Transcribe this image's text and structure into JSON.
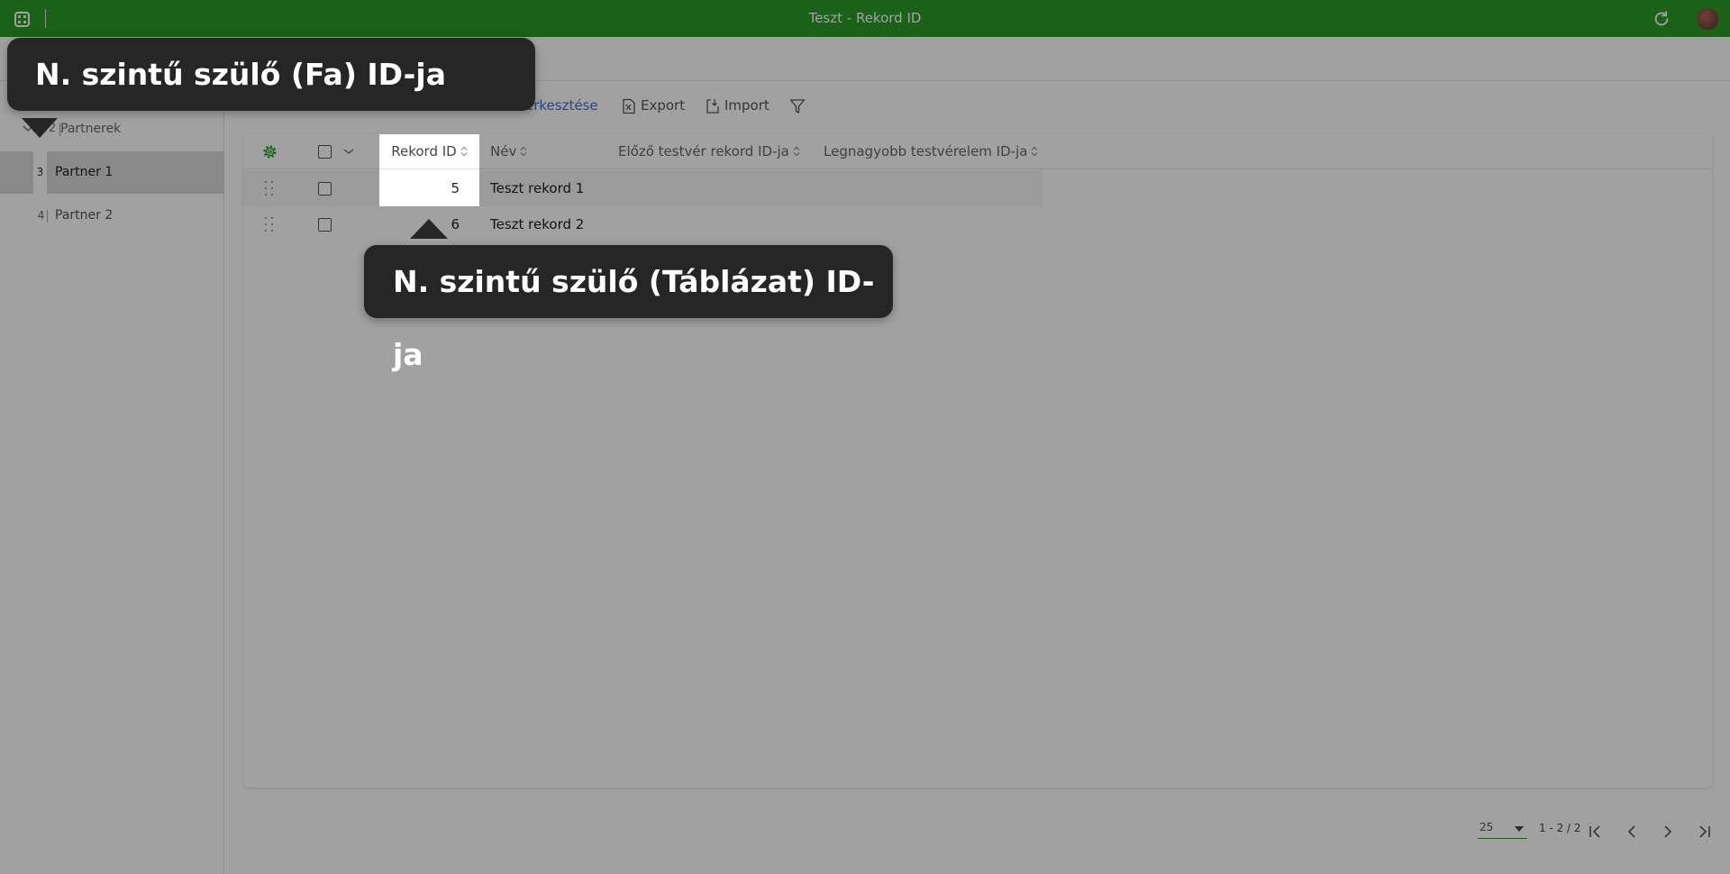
{
  "window": {
    "title": "Teszt - Rekord ID"
  },
  "tree": {
    "root": {
      "id": "2",
      "label": "Partnerek"
    },
    "items": [
      {
        "id": "3",
        "label": "Partner 1",
        "selected": true
      },
      {
        "id": "4",
        "label": "Partner 2",
        "selected": false
      }
    ]
  },
  "toolbar": {
    "edit_label": "erkesztése",
    "export_label": "Export",
    "import_label": "Import"
  },
  "table": {
    "columns": [
      "Rekord ID",
      "Név",
      "Előző testvér rekord ID-ja",
      "Legnagyobb testvérelem ID-ja"
    ],
    "rows": [
      {
        "id": "5",
        "name": "Teszt rekord 1"
      },
      {
        "id": "6",
        "name": "Teszt rekord 2"
      }
    ]
  },
  "pagination": {
    "page_size": "25",
    "range": "1 - 2 / 2"
  },
  "tooltips": {
    "tree": "N. szintű szülő (Fa) ID-ja",
    "table": "N. szintű szülő (Táblázat) ID-ja"
  },
  "colors": {
    "accent": "#2a9c27",
    "tooltip_bg": "#262626",
    "link": "#3b6fd4"
  }
}
